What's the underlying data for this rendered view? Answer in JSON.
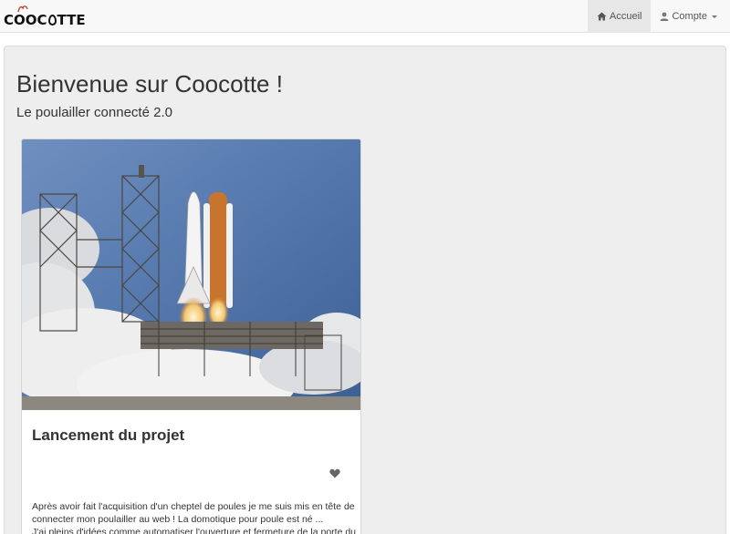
{
  "navbar": {
    "brand": {
      "text_before": "COOC",
      "text_after": "TTE"
    },
    "items": [
      {
        "label": "Accueil",
        "icon": "home-icon",
        "active": true
      },
      {
        "label": "Compte",
        "icon": "user-icon",
        "dropdown": true
      }
    ]
  },
  "jumbotron": {
    "title": "Bienvenue sur Coocotte !",
    "subtitle": "Le poulailler connecté 2.0"
  },
  "card": {
    "image": "space-shuttle-launch",
    "title": "Lancement du projet",
    "like_icon": "heart-icon",
    "text_lines": [
      "Après avoir fait l'acquisition d'un cheptel de poules je me suis mis en tête de",
      "connecter mon poulailler au web ! La domotique pour poule est né ...",
      "J'ai pleins d'idées comme automatiser l'ouverture et fermeture de la porte du"
    ]
  },
  "colors": {
    "navbar_bg": "#f8f8f8",
    "nav_active_bg": "#e7e7e7",
    "jumbotron_bg": "#eeeeee",
    "text": "#333333",
    "brand_crest": "#c0392b"
  }
}
